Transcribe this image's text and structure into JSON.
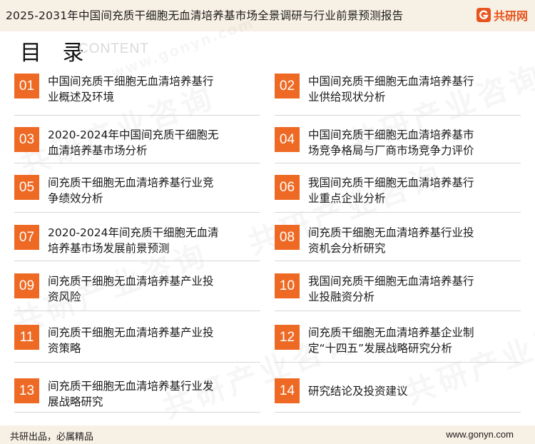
{
  "header": {
    "title": "2025-2031年中国间充质干细胞无血清培养基市场全景调研与行业前景预测报告",
    "brand_name": "共研网"
  },
  "toc": {
    "heading": "目 录",
    "subheading": "CONTENT",
    "entries": [
      {
        "num": "01",
        "lines": [
          "中国间充质干细胞无血清培养基行",
          "业概述及环境"
        ]
      },
      {
        "num": "02",
        "lines": [
          "中国间充质干细胞无血清培养基行",
          "业供给现状分析"
        ]
      },
      {
        "num": "03",
        "lines": [
          "2020-2024年中国间充质干细胞无",
          "血清培养基市场分析"
        ]
      },
      {
        "num": "04",
        "lines": [
          "中国间充质干细胞无血清培养基市",
          "场竞争格局与厂商市场竞争力评价"
        ]
      },
      {
        "num": "05",
        "lines": [
          "间充质干细胞无血清培养基行业竞",
          "争绩效分析"
        ]
      },
      {
        "num": "06",
        "lines": [
          "我国间充质干细胞无血清培养基行",
          "业重点企业分析"
        ]
      },
      {
        "num": "07",
        "lines": [
          "2020-2024年间充质干细胞无血清",
          "培养基市场发展前景预测"
        ]
      },
      {
        "num": "08",
        "lines": [
          "间充质干细胞无血清培养基行业投",
          "资机会分析研究"
        ]
      },
      {
        "num": "09",
        "lines": [
          "间充质干细胞无血清培养基产业投",
          "资风险"
        ]
      },
      {
        "num": "10",
        "lines": [
          "我国间充质干细胞无血清培养基行",
          "业投融资分析"
        ]
      },
      {
        "num": "11",
        "lines": [
          "间充质干细胞无血清培养基产业投",
          "资策略"
        ]
      },
      {
        "num": "12",
        "lines": [
          "间充质干细胞无血清培养基企业制",
          "定“十四五”发展战略研究分析"
        ]
      },
      {
        "num": "13",
        "lines": [
          "间充质干细胞无血清培养基行业发",
          "展战略研究"
        ]
      },
      {
        "num": "14",
        "lines": [
          "研究结论及投资建议"
        ]
      }
    ]
  },
  "watermark": {
    "text": "共研产业咨询",
    "site_text": "www.gonyn.com"
  },
  "footer": {
    "slogan": "共研出品，必属精品",
    "website": "www.gonyn.com"
  },
  "colors": {
    "accent": "#ee6a24",
    "band": "#f7f0e4",
    "rule": "#d6d6d6"
  }
}
